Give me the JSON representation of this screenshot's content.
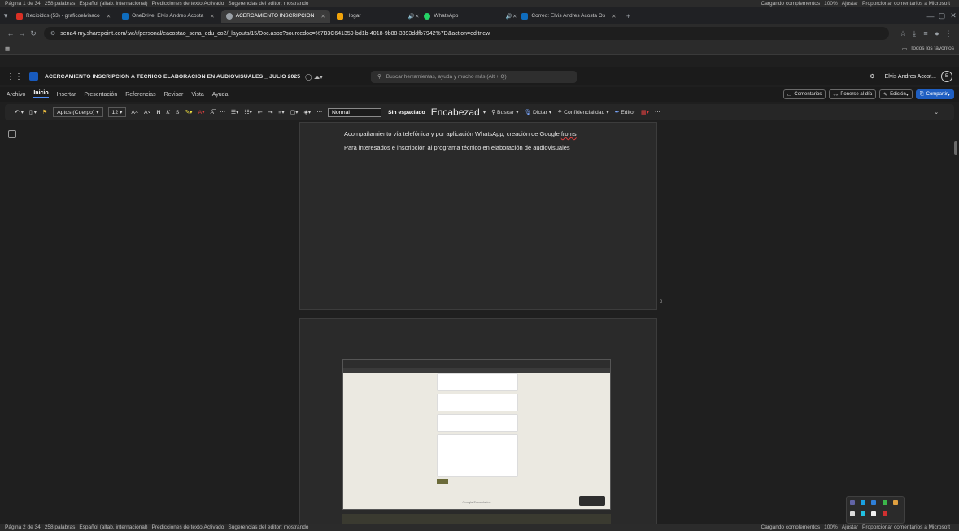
{
  "top_status": {
    "page_info": "Página 1 de 34",
    "words": "258 palabras",
    "language": "Español (alfab. internacional)",
    "predictions": "Predicciones de texto:Activado",
    "suggestions": "Sugerencias del editor: mostrando",
    "addins": "Cargando complementos",
    "zoom": "100%",
    "fit": "Ajustar",
    "feedback": "Proporcionar comentarios a Microsoft"
  },
  "bottom_status": {
    "page_info": "Página 2 de 34",
    "words": "258 palabras",
    "language": "Español (alfab. internacional)",
    "predictions": "Predicciones de texto:Activado",
    "suggestions": "Sugerencias del editor: mostrando",
    "addins": "Cargando complementos",
    "zoom": "100%",
    "fit": "Ajustar",
    "feedback": "Proporcionar comentarios a Microsoft"
  },
  "tabs": [
    {
      "label": "Recibidos (53) - graficoelvisaco",
      "color": "#d93025"
    },
    {
      "label": "OneDrive: Elvis Andres Acosta",
      "color": "#0f6cbd"
    },
    {
      "label": "ACERCAMIENTO INSCRIPCION",
      "color": "#9aa0a6",
      "active": true
    },
    {
      "label": "Hogar",
      "color": "#f0a30a"
    },
    {
      "label": "WhatsApp",
      "color": "#25d366"
    },
    {
      "label": "Correo: Elvis Andres Acosta Os",
      "color": "#0f6cbd"
    }
  ],
  "address": {
    "url": "sena4-my.sharepoint.com/:w:/r/personal/eacostao_sena_edu_co2/_layouts/15/Doc.aspx?sourcedoc=%7B3C641359-bd1b-4018-9b88-3393ddfb7942%7D&action=editnew"
  },
  "favorites": {
    "all_favorites": "Todos los favoritos"
  },
  "word": {
    "doc_title": "ACERCAMIENTO INSCRIPCION A TECNICO ELABORACION EN AUDIOVISUALES _ JULIO 2025",
    "search_placeholder": "Buscar herramientas, ayuda y mucho más (Alt + Q)",
    "user_name": "Elvis Andres Acost...",
    "user_initial": "E"
  },
  "menu": {
    "items": [
      "Archivo",
      "Inicio",
      "Insertar",
      "Presentación",
      "Referencias",
      "Revisar",
      "Vista",
      "Ayuda"
    ],
    "comments": "Comentarios",
    "catch_up": "Ponerse al día",
    "editing": "Edición",
    "share": "Compartir"
  },
  "ribbon": {
    "font": "Aptos (Cuerpo)",
    "size": "12",
    "style_normal": "Normal",
    "style_nospacing": "Sin espaciado",
    "style_heading": "Encabezad",
    "find": "Buscar",
    "dictate": "Dictar",
    "sensitivity": "Confidencialidad",
    "editor": "Editor"
  },
  "document": {
    "line1_pre": "Acompañamiento vía telefónica y por aplicación WhatsApp, creación de Google ",
    "line1_word": "froms",
    "line2": "Para interesados e inscripción al programa técnico en elaboración de audiovisuales",
    "page_number": "2",
    "form_footer": "Google Formularios"
  },
  "colors": {
    "accent": "#4f8ef7",
    "share_button": "#1f5fc2"
  }
}
